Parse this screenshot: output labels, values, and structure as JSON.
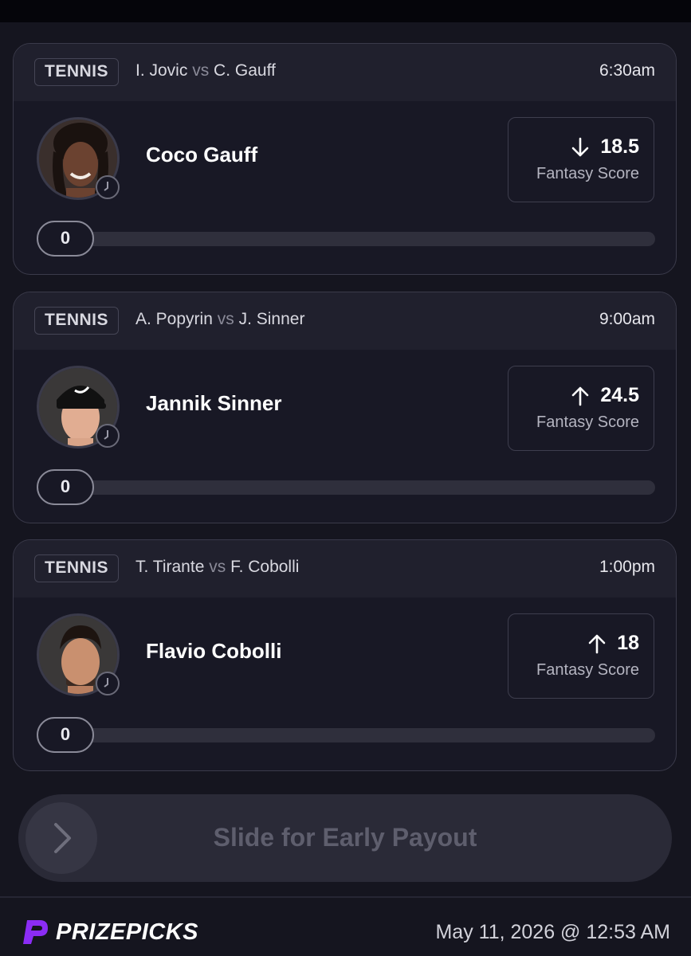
{
  "picks": [
    {
      "sport": "TENNIS",
      "team_a": "I. Jovic",
      "vs": "vs",
      "team_b": "C. Gauff",
      "time": "6:30am",
      "player": "Coco Gauff",
      "direction": "down",
      "line": "18.5",
      "stat": "Fantasy Score",
      "current": "0",
      "progress": 0
    },
    {
      "sport": "TENNIS",
      "team_a": "A. Popyrin",
      "vs": "vs",
      "team_b": "J. Sinner",
      "time": "9:00am",
      "player": "Jannik Sinner",
      "direction": "up",
      "line": "24.5",
      "stat": "Fantasy Score",
      "current": "0",
      "progress": 0
    },
    {
      "sport": "TENNIS",
      "team_a": "T. Tirante",
      "vs": "vs",
      "team_b": "F. Cobolli",
      "time": "1:00pm",
      "player": "Flavio Cobolli",
      "direction": "up",
      "line": "18",
      "stat": "Fantasy Score",
      "current": "0",
      "progress": 0
    }
  ],
  "slider": {
    "label": "Slide for Early Payout",
    "handle_icon": "chevron-right-icon"
  },
  "footer": {
    "brand": "PRIZEPICKS",
    "logo_icon": "prizepicks-logo-icon",
    "timestamp": "May 11, 2026 @ 12:53 AM"
  },
  "colors": {
    "background": "#15151f",
    "card": "#181825",
    "header": "#20202d",
    "brand_purple": "#8b2cf5"
  }
}
